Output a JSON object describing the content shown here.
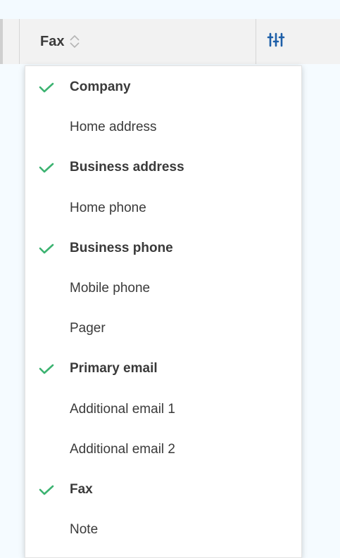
{
  "header": {
    "column_label": "Fax",
    "sort_icon": "sort-updown-icon",
    "settings_icon": "column-settings-icon",
    "accent_color": "#1e5fa8"
  },
  "menu": {
    "check_color": "#3cb371",
    "items": [
      {
        "label": "Company",
        "checked": true
      },
      {
        "label": "Home address",
        "checked": false
      },
      {
        "label": "Business address",
        "checked": true
      },
      {
        "label": "Home phone",
        "checked": false
      },
      {
        "label": "Business phone",
        "checked": true
      },
      {
        "label": "Mobile phone",
        "checked": false
      },
      {
        "label": "Pager",
        "checked": false
      },
      {
        "label": "Primary email",
        "checked": true
      },
      {
        "label": "Additional email 1",
        "checked": false
      },
      {
        "label": "Additional email 2",
        "checked": false
      },
      {
        "label": "Fax",
        "checked": true
      },
      {
        "label": "Note",
        "checked": false
      }
    ]
  }
}
